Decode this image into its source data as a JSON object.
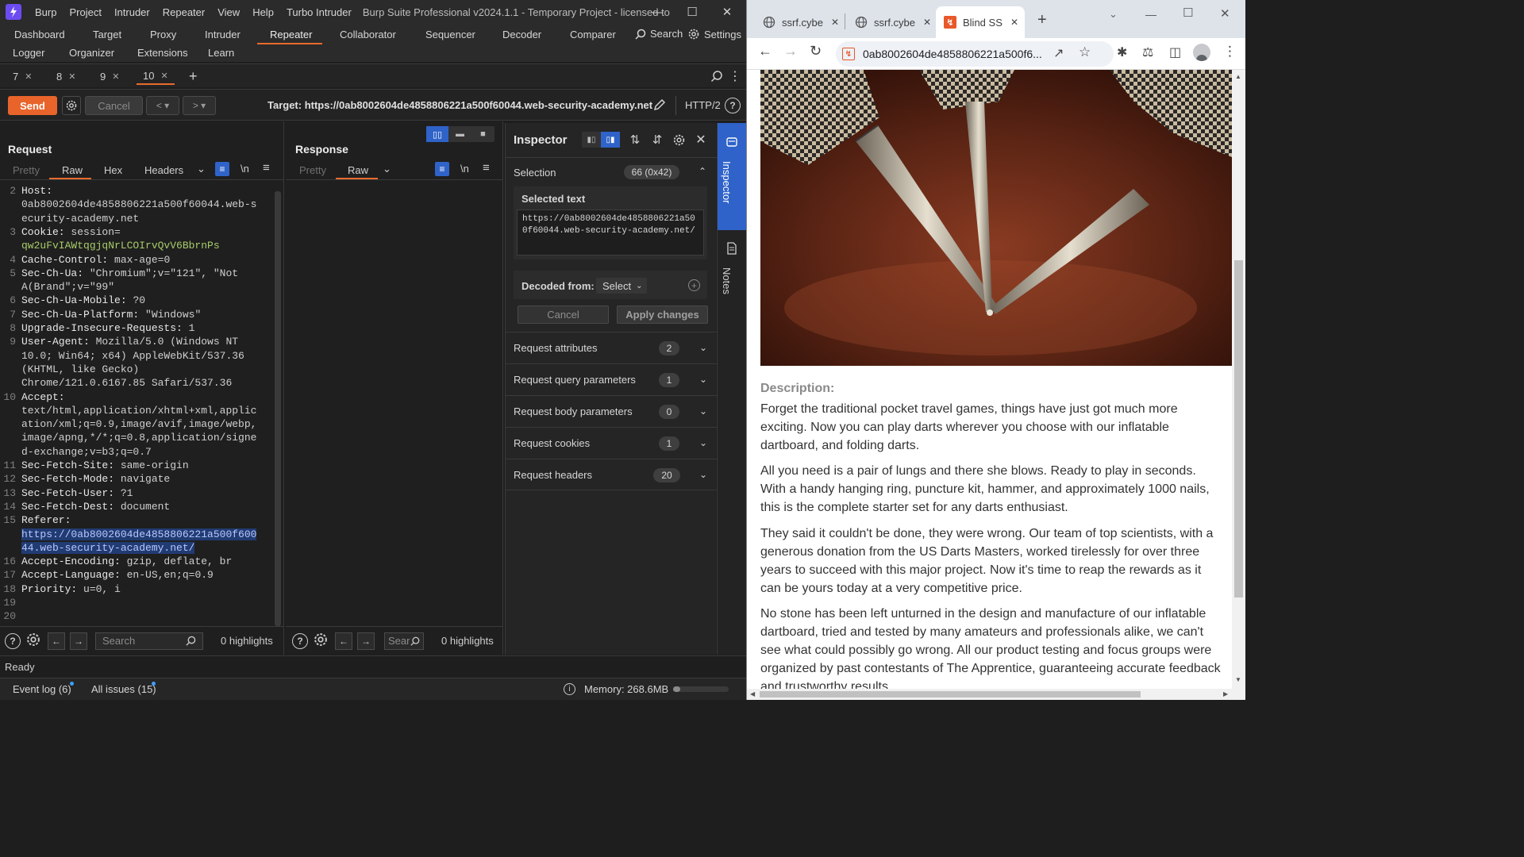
{
  "burp": {
    "menu": [
      "Burp",
      "Project",
      "Intruder",
      "Repeater",
      "View",
      "Help",
      "Turbo Intruder"
    ],
    "window_title": "Burp Suite Professional v2024.1.1 - Temporary Project - licensed to",
    "nav_row1": [
      "Dashboard",
      "Target",
      "Proxy",
      "Intruder",
      "Repeater",
      "Collaborator",
      "Sequencer",
      "Decoder",
      "Comparer"
    ],
    "nav_search": "Search",
    "nav_settings": "Settings",
    "nav_row2": [
      "Logger",
      "Organizer",
      "Extensions",
      "Learn"
    ],
    "repeater_tabs": [
      "7",
      "8",
      "9",
      "10"
    ],
    "active_tab": "10",
    "send_label": "Send",
    "cancel_label": "Cancel",
    "target": "Target: https://0ab8002604de4858806221a500f60044.web-security-academy.net",
    "http_version": "HTTP/2",
    "request": {
      "title": "Request",
      "tabs": [
        "Pretty",
        "Raw",
        "Hex",
        "Headers"
      ],
      "active_tab": "Raw",
      "search_placeholder": "Search",
      "highlights": "0 highlights"
    },
    "response": {
      "title": "Response",
      "tabs": [
        "Pretty",
        "Raw"
      ],
      "active_tab": "Raw",
      "search_placeholder": "Sear",
      "highlights": "0 highlights"
    },
    "inspector": {
      "title": "Inspector",
      "selection_label": "Selection",
      "selection_badge": "66 (0x42)",
      "selected_text_label": "Selected text",
      "selected_text": "https://0ab8002604de4858806221a500f60044.web-security-academy.net/",
      "decoded_from_label": "Decoded from:",
      "decoded_from_value": "Select",
      "cancel_label": "Cancel",
      "apply_label": "Apply changes",
      "sections": [
        {
          "label": "Request attributes",
          "count": "2"
        },
        {
          "label": "Request query parameters",
          "count": "1"
        },
        {
          "label": "Request body parameters",
          "count": "0"
        },
        {
          "label": "Request cookies",
          "count": "1"
        },
        {
          "label": "Request headers",
          "count": "20"
        }
      ]
    },
    "side_tabs": [
      "Inspector",
      "Notes"
    ],
    "status": "Ready",
    "event_log": "Event log (6)",
    "all_issues": "All issues (15)",
    "memory": "Memory: 268.6MB"
  },
  "request_lines": [
    {
      "n": "2",
      "parts": [
        {
          "t": "Host:",
          "c": "key"
        }
      ]
    },
    {
      "n": "",
      "parts": [
        {
          "t": "0ab8002604de4858806221a500f60044.web-s",
          "c": "val"
        }
      ]
    },
    {
      "n": "",
      "parts": [
        {
          "t": "ecurity-academy.net",
          "c": "val"
        }
      ]
    },
    {
      "n": "3",
      "parts": [
        {
          "t": "Cookie: ",
          "c": "key"
        },
        {
          "t": "session=",
          "c": "val"
        }
      ]
    },
    {
      "n": "",
      "parts": [
        {
          "t": "qw2uFvIAWtqgjqNrLCOIrvQvV6BbrnPs",
          "c": "cookie-val"
        }
      ]
    },
    {
      "n": "4",
      "parts": [
        {
          "t": "Cache-Control: ",
          "c": "key"
        },
        {
          "t": "max-age=0",
          "c": "val"
        }
      ]
    },
    {
      "n": "5",
      "parts": [
        {
          "t": "Sec-Ch-Ua: ",
          "c": "key"
        },
        {
          "t": "\"Chromium\";v=\"121\", \"Not",
          "c": "val"
        }
      ]
    },
    {
      "n": "",
      "parts": [
        {
          "t": "A(Brand\";v=\"99\"",
          "c": "val"
        }
      ]
    },
    {
      "n": "6",
      "parts": [
        {
          "t": "Sec-Ch-Ua-Mobile: ",
          "c": "key"
        },
        {
          "t": "?0",
          "c": "val"
        }
      ]
    },
    {
      "n": "7",
      "parts": [
        {
          "t": "Sec-Ch-Ua-Platform: ",
          "c": "key"
        },
        {
          "t": "\"Windows\"",
          "c": "val"
        }
      ]
    },
    {
      "n": "8",
      "parts": [
        {
          "t": "Upgrade-Insecure-Requests: ",
          "c": "key"
        },
        {
          "t": "1",
          "c": "val"
        }
      ]
    },
    {
      "n": "9",
      "parts": [
        {
          "t": "User-Agent: ",
          "c": "key"
        },
        {
          "t": "Mozilla/5.0 (Windows NT",
          "c": "val"
        }
      ]
    },
    {
      "n": "",
      "parts": [
        {
          "t": "10.0; Win64; x64) AppleWebKit/537.36",
          "c": "val"
        }
      ]
    },
    {
      "n": "",
      "parts": [
        {
          "t": "(KHTML, like Gecko)",
          "c": "val"
        }
      ]
    },
    {
      "n": "",
      "parts": [
        {
          "t": "Chrome/121.0.6167.85 Safari/537.36",
          "c": "val"
        }
      ]
    },
    {
      "n": "10",
      "parts": [
        {
          "t": "Accept:",
          "c": "key"
        }
      ]
    },
    {
      "n": "",
      "parts": [
        {
          "t": "text/html,application/xhtml+xml,applic",
          "c": "val"
        }
      ]
    },
    {
      "n": "",
      "parts": [
        {
          "t": "ation/xml;q=0.9,image/avif,image/webp,",
          "c": "val"
        }
      ]
    },
    {
      "n": "",
      "parts": [
        {
          "t": "image/apng,*/*;q=0.8,application/signe",
          "c": "val"
        }
      ]
    },
    {
      "n": "",
      "parts": [
        {
          "t": "d-exchange;v=b3;q=0.7",
          "c": "val"
        }
      ]
    },
    {
      "n": "11",
      "parts": [
        {
          "t": "Sec-Fetch-Site: ",
          "c": "key"
        },
        {
          "t": "same-origin",
          "c": "val"
        }
      ]
    },
    {
      "n": "12",
      "parts": [
        {
          "t": "Sec-Fetch-Mode: ",
          "c": "key"
        },
        {
          "t": "navigate",
          "c": "val"
        }
      ]
    },
    {
      "n": "13",
      "parts": [
        {
          "t": "Sec-Fetch-User: ",
          "c": "key"
        },
        {
          "t": "?1",
          "c": "val"
        }
      ]
    },
    {
      "n": "14",
      "parts": [
        {
          "t": "Sec-Fetch-Dest: ",
          "c": "key"
        },
        {
          "t": "document",
          "c": "val"
        }
      ]
    },
    {
      "n": "15",
      "parts": [
        {
          "t": "Referer:",
          "c": "key"
        }
      ]
    },
    {
      "n": "",
      "parts": [
        {
          "t": "https://0ab8002604de4858806221a500f600",
          "c": "sel"
        }
      ]
    },
    {
      "n": "",
      "parts": [
        {
          "t": "44.web-security-academy.net/",
          "c": "sel"
        }
      ]
    },
    {
      "n": "16",
      "parts": [
        {
          "t": "Accept-Encoding: ",
          "c": "key"
        },
        {
          "t": "gzip, deflate, br",
          "c": "val"
        }
      ]
    },
    {
      "n": "17",
      "parts": [
        {
          "t": "Accept-Language: ",
          "c": "key"
        },
        {
          "t": "en-US,en;q=0.9",
          "c": "val"
        }
      ]
    },
    {
      "n": "18",
      "parts": [
        {
          "t": "Priority: ",
          "c": "key"
        },
        {
          "t": "u=0, i",
          "c": "val"
        }
      ]
    },
    {
      "n": "19",
      "parts": []
    },
    {
      "n": "20",
      "parts": []
    }
  ],
  "chrome": {
    "tabs": [
      {
        "label": "ssrf.cybe",
        "active": false
      },
      {
        "label": "ssrf.cybe",
        "active": false
      },
      {
        "label": "Blind SS",
        "active": true
      }
    ],
    "url": "0ab8002604de4858806221a500f6...",
    "description_label": "Description:",
    "paragraphs": [
      "Forget the traditional pocket travel games, things have just got much more exciting. Now you can play darts wherever you choose with our inflatable dartboard, and folding darts.",
      "All you need is a pair of lungs and there she blows. Ready to play in seconds. With a handy hanging ring, puncture kit, hammer, and approximately 1000 nails, this is the complete starter set for any darts enthusiast.",
      "They said it couldn't be done, they were wrong. Our team of top scientists, with a generous donation from the US Darts Masters, worked tirelessly for over three years to succeed with this major project. Now it's time to reap the rewards as it can be yours today at a very competitive price.",
      "No stone has been left unturned in the design and manufacture of our inflatable dartboard, tried and tested by many amateurs and professionals alike, we can't see what could possibly go wrong. All our product testing and focus groups were organized by past contestants of The Apprentice, guaranteeing accurate feedback and trustworthy results."
    ]
  }
}
